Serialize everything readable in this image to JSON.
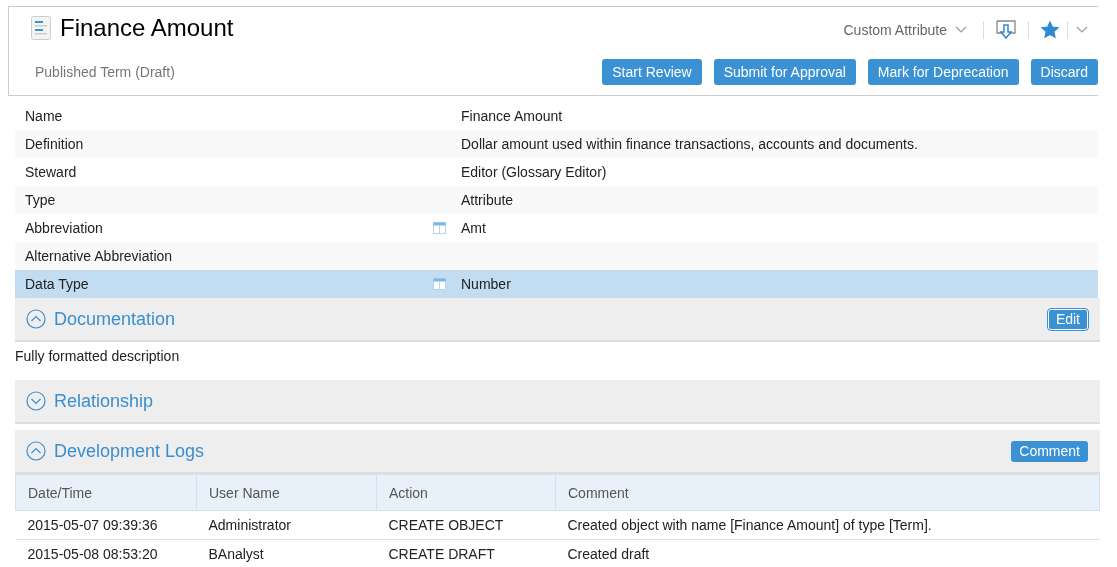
{
  "header": {
    "title": "Finance Amount",
    "subtitle": "Published Term (Draft)",
    "attribute_menu": "Custom Attribute",
    "favorite": true
  },
  "actions": [
    "Start Review",
    "Submit for Approval",
    "Mark for Deprecation",
    "Discard"
  ],
  "properties": [
    {
      "label": "Name",
      "value": "Finance Amount",
      "has_icon": false,
      "selected": false
    },
    {
      "label": "Definition",
      "value": "Dollar amount used within finance transactions, accounts and documents.",
      "has_icon": false,
      "selected": false
    },
    {
      "label": "Steward",
      "value": "Editor (Glossary Editor)",
      "has_icon": false,
      "selected": false
    },
    {
      "label": "Type",
      "value": "Attribute",
      "has_icon": false,
      "selected": false
    },
    {
      "label": "Abbreviation",
      "value": "Amt",
      "has_icon": true,
      "selected": false
    },
    {
      "label": "Alternative Abbreviation",
      "has_icon": false,
      "selected": false
    },
    {
      "label": "Data Type",
      "value": "Number",
      "has_icon": true,
      "selected": true
    }
  ],
  "sections": [
    {
      "title": "Documentation",
      "expanded": true,
      "button": "Edit",
      "body": "Fully formatted description"
    },
    {
      "title": "Relationship",
      "expanded": false
    },
    {
      "title": "Development Logs",
      "expanded": true,
      "button": "Comment",
      "table": {
        "columns": [
          "Date/Time",
          "User Name",
          "Action",
          "Comment"
        ],
        "rows": [
          [
            "2015-05-07 09:39:36",
            "Administrator",
            "CREATE OBJECT",
            "Created object with name [Finance Amount] of type [Term]."
          ],
          [
            "2015-05-08 08:53:20",
            "BAnalyst",
            "CREATE DRAFT",
            "Created draft"
          ]
        ]
      }
    }
  ]
}
